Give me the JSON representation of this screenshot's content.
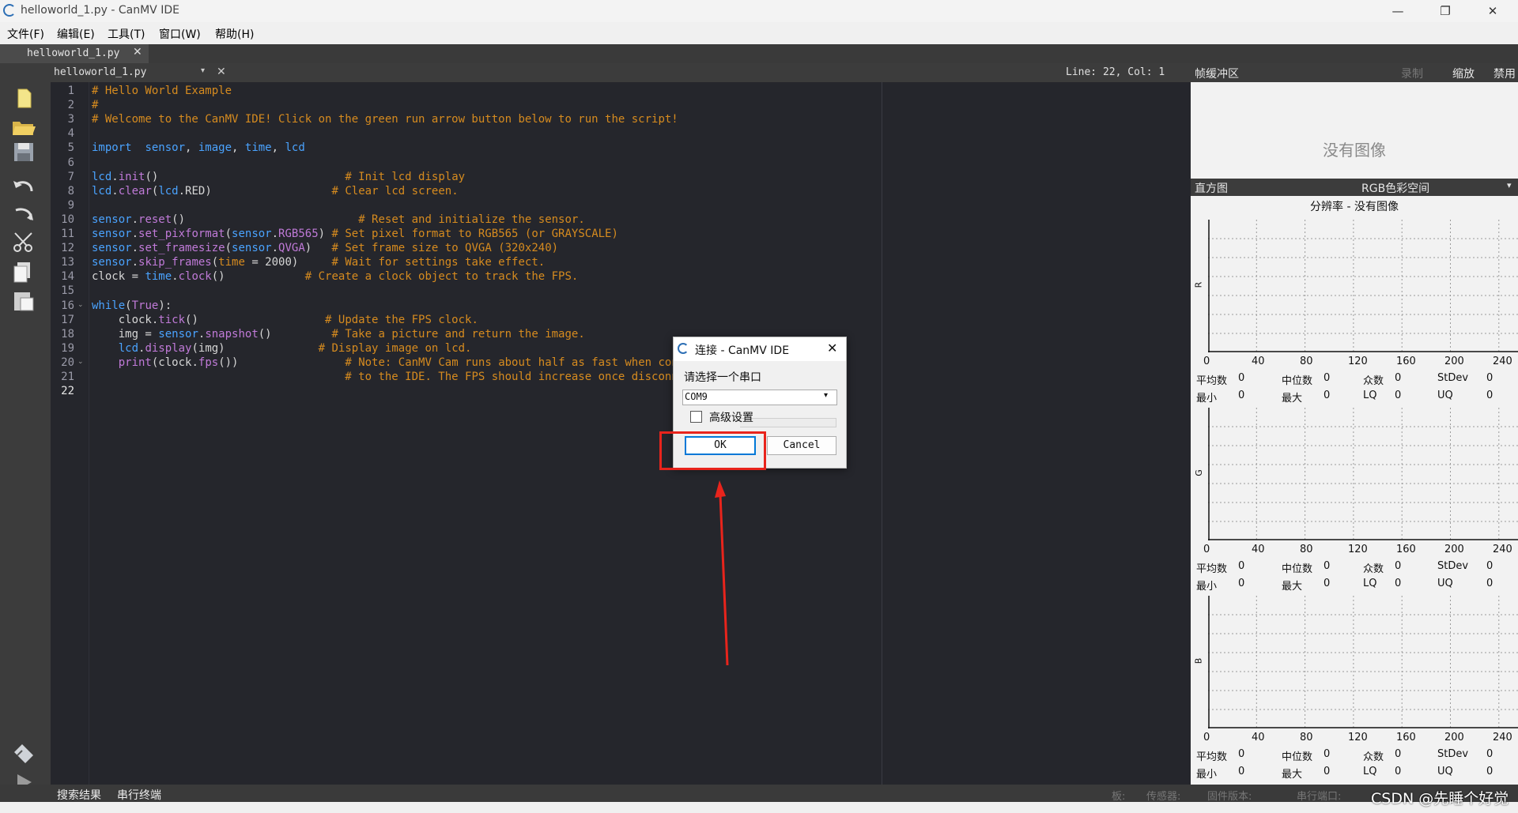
{
  "window": {
    "title": "helloworld_1.py - CanMV IDE",
    "minimize_glyph": "—",
    "maximize_glyph": "❐",
    "close_glyph": "✕"
  },
  "menu": [
    "文件(F)",
    "编辑(E)",
    "工具(T)",
    "窗口(W)",
    "帮助(H)"
  ],
  "file_tab": {
    "label": "helloworld_1.py",
    "close_glyph": "✕"
  },
  "editor": {
    "file_name": "helloworld_1.py",
    "dropdown_glyph": "▾",
    "close_glyph": "✕",
    "cursor_position": "Line: 22, Col: 1",
    "line_numbers": [
      "1",
      "2",
      "3",
      "4",
      "5",
      "6",
      "7",
      "8",
      "9",
      "10",
      "11",
      "12",
      "13",
      "14",
      "15",
      "16",
      "17",
      "18",
      "19",
      "20",
      "21",
      "22"
    ],
    "lines": [
      [
        [
          "cm",
          "# Hello World Example"
        ]
      ],
      [
        [
          "cm",
          "#"
        ]
      ],
      [
        [
          "cm",
          "# Welcome to the CanMV IDE! Click on the green run arrow button below to run the script!"
        ]
      ],
      [],
      [
        [
          "kw",
          "import"
        ],
        [
          "",
          "  "
        ],
        [
          "kw",
          "sensor"
        ],
        [
          "",
          ", "
        ],
        [
          "kw",
          "image"
        ],
        [
          "",
          ", "
        ],
        [
          "kw",
          "time"
        ],
        [
          "",
          ", "
        ],
        [
          "kw",
          "lcd"
        ]
      ],
      [],
      [
        [
          "kw",
          "lcd"
        ],
        [
          "",
          "."
        ],
        [
          "pu",
          "init"
        ],
        [
          "",
          "()                            "
        ],
        [
          "cm",
          "# Init lcd display"
        ]
      ],
      [
        [
          "kw",
          "lcd"
        ],
        [
          "",
          "."
        ],
        [
          "pu",
          "clear"
        ],
        [
          "",
          "("
        ],
        [
          "kw",
          "lcd"
        ],
        [
          "",
          ".RED)                  "
        ],
        [
          "cm",
          "# Clear lcd screen."
        ]
      ],
      [],
      [
        [
          "kw",
          "sensor"
        ],
        [
          "",
          "."
        ],
        [
          "pu",
          "reset"
        ],
        [
          "",
          "()                          "
        ],
        [
          "cm",
          "# Reset and initialize the sensor."
        ]
      ],
      [
        [
          "kw",
          "sensor"
        ],
        [
          "",
          "."
        ],
        [
          "pu",
          "set_pixformat"
        ],
        [
          "",
          "("
        ],
        [
          "kw",
          "sensor"
        ],
        [
          "",
          "."
        ],
        [
          "pu",
          "RGB565"
        ],
        [
          "",
          ") "
        ],
        [
          "cm",
          "# Set pixel format to RGB565 (or GRAYSCALE)"
        ]
      ],
      [
        [
          "kw",
          "sensor"
        ],
        [
          "",
          "."
        ],
        [
          "pu",
          "set_framesize"
        ],
        [
          "",
          "("
        ],
        [
          "kw",
          "sensor"
        ],
        [
          "",
          "."
        ],
        [
          "pu",
          "QVGA"
        ],
        [
          "",
          ")   "
        ],
        [
          "cm",
          "# Set frame size to QVGA (320x240)"
        ]
      ],
      [
        [
          "kw",
          "sensor"
        ],
        [
          "",
          "."
        ],
        [
          "pu",
          "skip_frames"
        ],
        [
          "",
          "("
        ],
        [
          "cm",
          "time"
        ],
        [
          "",
          " = 2000)     "
        ],
        [
          "cm",
          "# Wait for settings take effect."
        ]
      ],
      [
        [
          "",
          "clock = "
        ],
        [
          "kw",
          "time"
        ],
        [
          "",
          "."
        ],
        [
          "pu",
          "clock"
        ],
        [
          "",
          "()            "
        ],
        [
          "cm",
          "# Create a clock object to track the FPS."
        ]
      ],
      [],
      [
        [
          "kw",
          "while"
        ],
        [
          "",
          "("
        ],
        [
          "pu",
          "True"
        ],
        [
          "",
          "):"
        ]
      ],
      [
        [
          "",
          "    clock."
        ],
        [
          "pu",
          "tick"
        ],
        [
          "",
          "()                   "
        ],
        [
          "cm",
          "# Update the FPS clock."
        ]
      ],
      [
        [
          "",
          "    img = "
        ],
        [
          "kw",
          "sensor"
        ],
        [
          "",
          "."
        ],
        [
          "pu",
          "snapshot"
        ],
        [
          "",
          "()         "
        ],
        [
          "cm",
          "# Take a picture and return the image."
        ]
      ],
      [
        [
          "",
          "    "
        ],
        [
          "kw",
          "lcd"
        ],
        [
          "",
          "."
        ],
        [
          "pu",
          "display"
        ],
        [
          "",
          "(img)              "
        ],
        [
          "cm",
          "# Display image on lcd."
        ]
      ],
      [
        [
          "",
          "    "
        ],
        [
          "pu",
          "print"
        ],
        [
          "",
          "(clock."
        ],
        [
          "pu",
          "fps"
        ],
        [
          "",
          "())                "
        ],
        [
          "cm",
          "# Note: CanMV Cam runs about half as fast when connected"
        ]
      ],
      [
        [
          "",
          "                                      "
        ],
        [
          "cm",
          "# to the IDE. The FPS should increase once disconnected."
        ]
      ],
      []
    ]
  },
  "framebuffer": {
    "title": "帧缓冲区",
    "record": "录制",
    "zoom": "缩放",
    "disable": "禁用",
    "no_image": "没有图像"
  },
  "histogram": {
    "title": "直方图",
    "colorspace": "RGB色彩空间",
    "dropdown_glyph": "▾",
    "resolution": "分辨率 - 没有图像",
    "ticks": [
      "0",
      "40",
      "80",
      "120",
      "160",
      "200",
      "240"
    ],
    "channels": [
      {
        "axis": "R",
        "mean_label": "平均数",
        "mean": "0",
        "median_label": "中位数",
        "median": "0",
        "mode_label": "众数",
        "mode": "0",
        "stdev_label": "StDev",
        "stdev": "0",
        "min_label": "最小",
        "min": "0",
        "max_label": "最大",
        "max": "0",
        "lq_label": "LQ",
        "lq": "0",
        "uq_label": "UQ",
        "uq": "0"
      },
      {
        "axis": "G",
        "mean_label": "平均数",
        "mean": "0",
        "median_label": "中位数",
        "median": "0",
        "mode_label": "众数",
        "mode": "0",
        "stdev_label": "StDev",
        "stdev": "0",
        "min_label": "最小",
        "min": "0",
        "max_label": "最大",
        "max": "0",
        "lq_label": "LQ",
        "lq": "0",
        "uq_label": "UQ",
        "uq": "0"
      },
      {
        "axis": "B",
        "mean_label": "平均数",
        "mean": "0",
        "median_label": "中位数",
        "median": "0",
        "mode_label": "众数",
        "mode": "0",
        "stdev_label": "StDev",
        "stdev": "0",
        "min_label": "最小",
        "min": "0",
        "max_label": "最大",
        "max": "0",
        "lq_label": "LQ",
        "lq": "0",
        "uq_label": "UQ",
        "uq": "0"
      }
    ]
  },
  "bottom_tabs": {
    "search": "搜索结果",
    "serial": "串行终端"
  },
  "status": {
    "board": "板:",
    "sensor": "传感器:",
    "firmware": "固件版本:",
    "port": "串行端口:"
  },
  "dialog": {
    "title": "连接 - CanMV IDE",
    "close_glyph": "✕",
    "prompt": "请选择一个串口",
    "port_value": "COM9",
    "dropdown_glyph": "▾",
    "advanced_label": "高级设置",
    "advanced_checked": false,
    "ok": "OK",
    "cancel": "Cancel"
  },
  "watermark": "CSDN @先睡个好觉",
  "colors": {
    "highlight": "#e8241c",
    "arrow": "#e8241c",
    "comment": "#d68b1f",
    "keyword": "#4aa3ff",
    "builtin": "#c07ad8"
  }
}
